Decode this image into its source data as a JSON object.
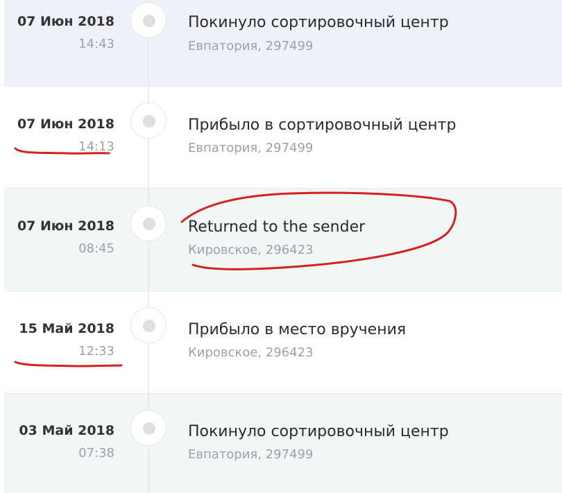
{
  "events": [
    {
      "date": "07 Июн 2018",
      "time": "14:43",
      "title": "Покинуло сортировочный центр",
      "place": "Евпатория, 297499"
    },
    {
      "date": "07 Июн 2018",
      "time": "14:13",
      "title": "Прибыло в сортировочный центр",
      "place": "Евпатория, 297499"
    },
    {
      "date": "07 Июн 2018",
      "time": "08:45",
      "title": "Returned to the sender",
      "place": "Кировское, 296423"
    },
    {
      "date": "15 Май 2018",
      "time": "12:33",
      "title": "Прибыло в место вручения",
      "place": "Кировское, 296423"
    },
    {
      "date": "03 Май 2018",
      "time": "07:38",
      "title": "Покинуло сортировочный центр",
      "place": "Евпатория, 297499"
    }
  ],
  "annotations": {
    "stroke_color": "#d61f1f",
    "items": [
      "underline-time-event-2",
      "circle-title-event-3",
      "underline-time-event-4"
    ]
  }
}
